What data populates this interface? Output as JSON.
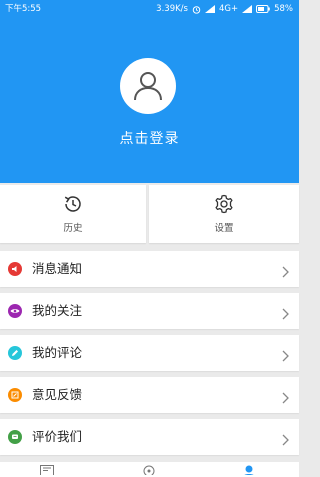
{
  "status_bar": {
    "time": "下午5:55",
    "speed": "3.39K/s",
    "network": "4G+",
    "battery": "58%"
  },
  "header": {
    "login_text": "点击登录"
  },
  "quick_actions": [
    {
      "label": "历史",
      "icon": "history-icon"
    },
    {
      "label": "设置",
      "icon": "gear-icon"
    }
  ],
  "menu": {
    "items": [
      {
        "label": "消息通知",
        "icon": "speaker-icon",
        "color": "#e53935"
      },
      {
        "label": "我的关注",
        "icon": "eye-icon",
        "color": "#9c27b0"
      },
      {
        "label": "我的评论",
        "icon": "pen-icon",
        "color": "#26c6da"
      },
      {
        "label": "意见反馈",
        "icon": "feedback-icon",
        "color": "#fb8c00"
      },
      {
        "label": "评价我们",
        "icon": "rate-icon",
        "color": "#43a047"
      }
    ]
  },
  "colors": {
    "brand": "#2196f3",
    "background": "#eaeaea"
  }
}
